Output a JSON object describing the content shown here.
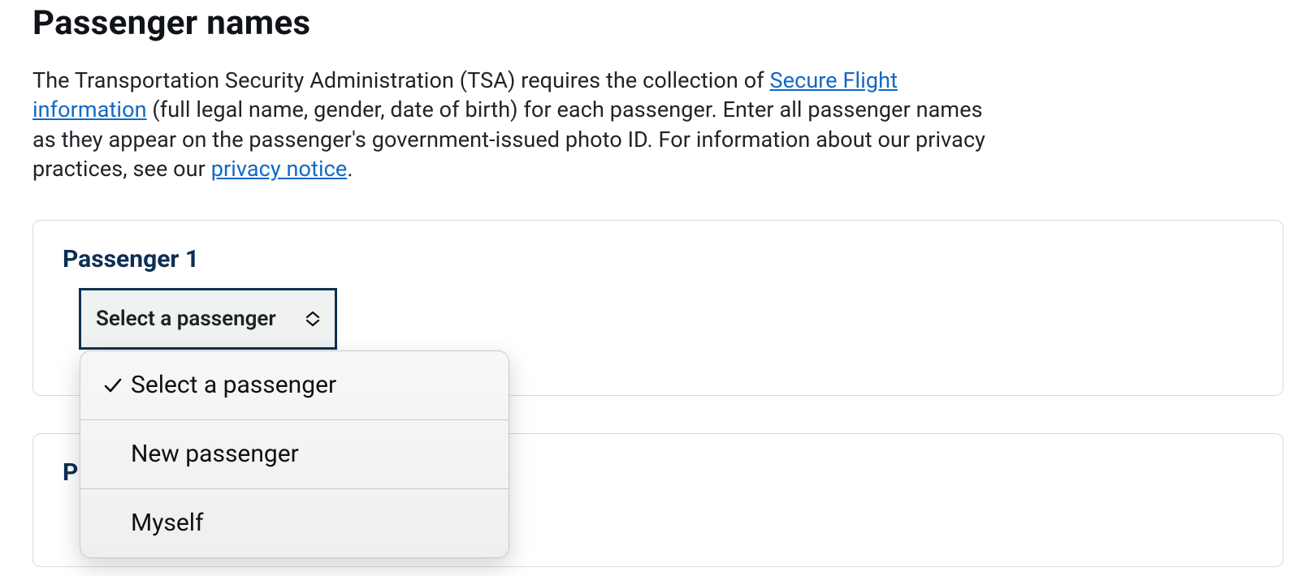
{
  "heading": "Passenger names",
  "intro": {
    "part1": "The Transportation Security Administration (TSA) requires the collection of ",
    "link1": "Secure Flight information",
    "part2": " (full legal name, gender, date of birth) for each passenger. Enter all passenger names as they appear on the passenger's government-issued photo ID. For information about our privacy practices, see our ",
    "link2": "privacy notice",
    "part3": "."
  },
  "passenger1": {
    "title": "Passenger 1",
    "select_label": "Select a passenger",
    "options": {
      "o0": "Select a passenger",
      "o1": "New passenger",
      "o2": "Myself"
    }
  },
  "passenger2": {
    "title_visible_fragment": "P"
  },
  "colors": {
    "link": "#1368c6",
    "card_title": "#0c2f55",
    "select_border": "#0c2f55"
  }
}
